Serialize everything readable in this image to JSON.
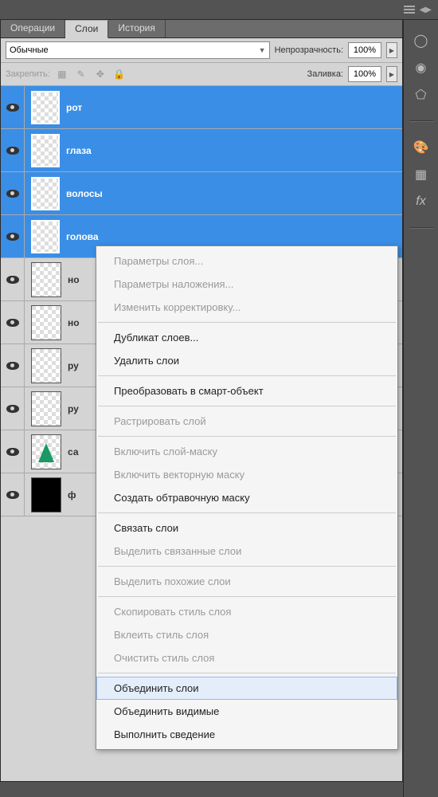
{
  "tabs": {
    "operations": "Операции",
    "layers": "Слои",
    "history": "История"
  },
  "controls": {
    "blend_mode": "Обычные",
    "opacity_label": "Непрозрачность:",
    "opacity_value": "100%",
    "fill_label": "Заливка:",
    "fill_value": "100%",
    "lock_label": "Закрепить:"
  },
  "layers": [
    {
      "name": "рот",
      "selected": true,
      "thumb": "checker"
    },
    {
      "name": "глаза",
      "selected": true,
      "thumb": "checker"
    },
    {
      "name": "волосы",
      "selected": true,
      "thumb": "checker"
    },
    {
      "name": "голова",
      "selected": true,
      "thumb": "checker"
    },
    {
      "name": "но",
      "selected": false,
      "thumb": "checker"
    },
    {
      "name": "но",
      "selected": false,
      "thumb": "checker"
    },
    {
      "name": "ру",
      "selected": false,
      "thumb": "checker"
    },
    {
      "name": "ру",
      "selected": false,
      "thumb": "checker"
    },
    {
      "name": "са",
      "selected": false,
      "thumb": "tree"
    },
    {
      "name": "ф",
      "selected": false,
      "thumb": "black"
    }
  ],
  "context_menu": [
    {
      "label": "Параметры слоя...",
      "disabled": true
    },
    {
      "label": "Параметры наложения...",
      "disabled": true
    },
    {
      "label": "Изменить корректировку...",
      "disabled": true
    },
    {
      "sep": true
    },
    {
      "label": "Дубликат слоев...",
      "disabled": false
    },
    {
      "label": "Удалить слои",
      "disabled": false
    },
    {
      "sep": true
    },
    {
      "label": "Преобразовать в смарт-объект",
      "disabled": false
    },
    {
      "sep": true
    },
    {
      "label": "Растрировать слой",
      "disabled": true
    },
    {
      "sep": true
    },
    {
      "label": "Включить слой-маску",
      "disabled": true
    },
    {
      "label": "Включить векторную маску",
      "disabled": true
    },
    {
      "label": "Создать обтравочную маску",
      "disabled": false
    },
    {
      "sep": true
    },
    {
      "label": "Связать слои",
      "disabled": false
    },
    {
      "label": "Выделить связанные слои",
      "disabled": true
    },
    {
      "sep": true
    },
    {
      "label": "Выделить похожие слои",
      "disabled": true
    },
    {
      "sep": true
    },
    {
      "label": "Скопировать стиль слоя",
      "disabled": true
    },
    {
      "label": "Вклеить стиль слоя",
      "disabled": true
    },
    {
      "label": "Очистить стиль слоя",
      "disabled": true
    },
    {
      "sep": true
    },
    {
      "label": "Объединить слои",
      "disabled": false,
      "highlighted": true
    },
    {
      "label": "Объединить видимые",
      "disabled": false
    },
    {
      "label": "Выполнить сведение",
      "disabled": false
    }
  ],
  "sidebar_icons": {
    "lens": "lens-icon",
    "sphere": "sphere-icon",
    "shape": "shape-icon",
    "palette": "palette-icon",
    "grid": "grid-icon",
    "fx": "fx-icon"
  }
}
